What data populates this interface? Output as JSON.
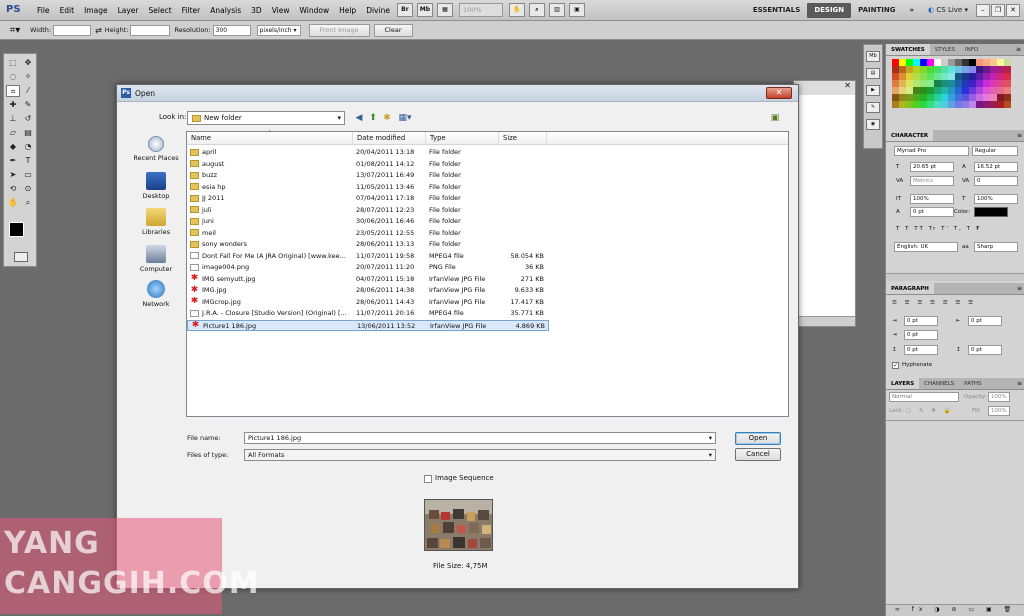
{
  "menubar": {
    "logo": "PS",
    "items": [
      "File",
      "Edit",
      "Image",
      "Layer",
      "Select",
      "Filter",
      "Analysis",
      "3D",
      "View",
      "Window",
      "Help",
      "Divine"
    ],
    "icons": [
      "Br",
      "Mb"
    ],
    "zoom": "100%",
    "workspaces": [
      "ESSENTIALS",
      "DESIGN",
      "PAINTING"
    ],
    "active_workspace": "DESIGN",
    "more": "»",
    "cs_live": "CS Live"
  },
  "options_bar": {
    "width_label": "Width:",
    "height_label": "Height:",
    "resolution_label": "Resolution:",
    "resolution_value": "300",
    "unit_value": "pixels/inch",
    "front_image_label": "Front Image",
    "clear_label": "Clear"
  },
  "panels": {
    "swatches_tabs": [
      "SWATCHES",
      "STYLES",
      "INFO"
    ],
    "character_tab": "CHARACTER",
    "font_family": "Myriad Pro",
    "font_style": "Regular",
    "font_size": "20.65 pt",
    "leading": "16.52 pt",
    "kerning": "Metrics",
    "tracking": "0",
    "vscale": "100%",
    "hscale": "100%",
    "baseline": "0 pt",
    "color_label": "Color:",
    "language": "English: UK",
    "aa": "Sharp",
    "paragraph_tab": "PARAGRAPH",
    "indent_left": "0 pt",
    "indent_right": "0 pt",
    "indent_first": "0 pt",
    "space_before": "0 pt",
    "space_after": "0 pt",
    "hyphenate": "Hyphenate",
    "layers_tabs": [
      "LAYERS",
      "CHANNELS",
      "PATHS"
    ],
    "blend_mode": "Normal",
    "opacity_label": "Opacity:",
    "opacity_value": "100%",
    "lock_label": "Lock:",
    "fill_label": "Fill:",
    "fill_value": "100%"
  },
  "dialog": {
    "title": "Open",
    "close": "✕",
    "look_in_label": "Look in:",
    "look_in_value": "New folder",
    "places": [
      "Recent Places",
      "Desktop",
      "Libraries",
      "Computer",
      "Network"
    ],
    "columns": [
      "Name",
      "Date modified",
      "Type",
      "Size"
    ],
    "files": [
      {
        "name": "april",
        "date": "20/04/2011 13:18",
        "type": "File folder",
        "size": "",
        "kind": "folder"
      },
      {
        "name": "august",
        "date": "01/08/2011 14:12",
        "type": "File folder",
        "size": "",
        "kind": "folder"
      },
      {
        "name": "buzz",
        "date": "13/07/2011 16:49",
        "type": "File folder",
        "size": "",
        "kind": "folder"
      },
      {
        "name": "esia hp",
        "date": "11/05/2011 13:46",
        "type": "File folder",
        "size": "",
        "kind": "folder"
      },
      {
        "name": "JJ 2011",
        "date": "07/04/2011 17:18",
        "type": "File folder",
        "size": "",
        "kind": "folder"
      },
      {
        "name": "juli",
        "date": "28/07/2011 12:23",
        "type": "File folder",
        "size": "",
        "kind": "folder"
      },
      {
        "name": "juni",
        "date": "30/06/2011 16:46",
        "type": "File folder",
        "size": "",
        "kind": "folder"
      },
      {
        "name": "meil",
        "date": "23/05/2011 12:55",
        "type": "File folder",
        "size": "",
        "kind": "folder"
      },
      {
        "name": "sony wonders",
        "date": "28/06/2011 13:13",
        "type": "File folder",
        "size": "",
        "kind": "folder"
      },
      {
        "name": "Dont Fall For Me (A JRA Original) [www.kee...",
        "date": "11/07/2011 19:58",
        "type": "MPEG4 file",
        "size": "58.054 KB",
        "kind": "file"
      },
      {
        "name": "image004.png",
        "date": "20/07/2011 11:20",
        "type": "PNG File",
        "size": "36 KB",
        "kind": "file"
      },
      {
        "name": "IMG semyutt.jpg",
        "date": "04/07/2011 15:18",
        "type": "IrfanView JPG File",
        "size": "271 KB",
        "kind": "irfan"
      },
      {
        "name": "IMG.jpg",
        "date": "28/06/2011 14:38",
        "type": "IrfanView JPG File",
        "size": "9.633 KB",
        "kind": "irfan"
      },
      {
        "name": "IMGcrop.jpg",
        "date": "28/06/2011 14:43",
        "type": "IrfanView JPG File",
        "size": "17.417 KB",
        "kind": "irfan"
      },
      {
        "name": "J.R.A. - Closure [Studio Version] (Original) [...",
        "date": "11/07/2011 20:16",
        "type": "MPEG4 file",
        "size": "35.771 KB",
        "kind": "file"
      },
      {
        "name": "Picture1 186.jpg",
        "date": "13/06/2011 13:52",
        "type": "IrfanView JPG File",
        "size": "4.869 KB",
        "kind": "irfan"
      }
    ],
    "selected_index": 15,
    "file_name_label": "File name:",
    "file_name_value": "Picture1 186.jpg",
    "file_type_label": "Files of type:",
    "file_type_value": "All Formats",
    "open_label": "Open",
    "cancel_label": "Cancel",
    "image_sequence_label": "Image Sequence",
    "file_size": "File Size: 4,75M"
  },
  "watermark": {
    "line1": "YANG",
    "line2": "CANGGIH.COM"
  },
  "colors": {
    "selection": "#d9e9fb",
    "accent": "#3c7fb1"
  }
}
